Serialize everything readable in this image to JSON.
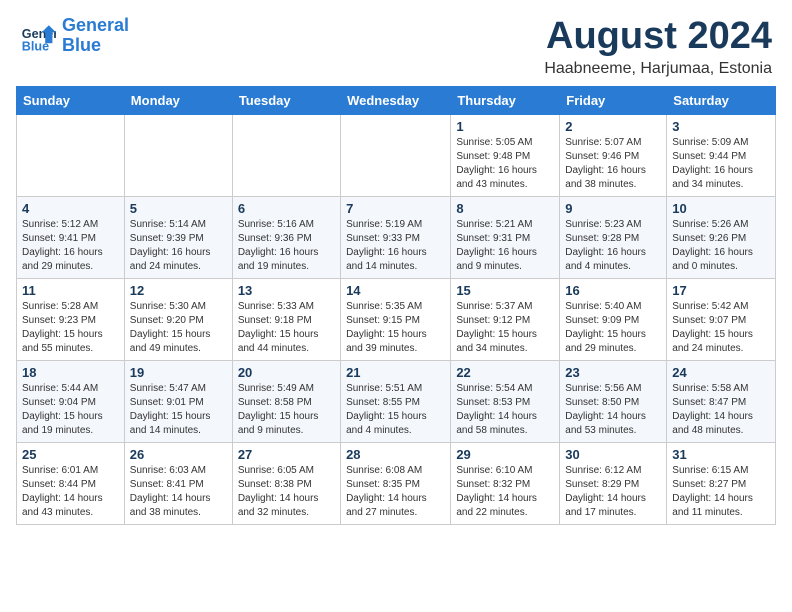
{
  "header": {
    "logo_line1": "General",
    "logo_line2": "Blue",
    "month_year": "August 2024",
    "location": "Haabneeme, Harjumaa, Estonia"
  },
  "weekdays": [
    "Sunday",
    "Monday",
    "Tuesday",
    "Wednesday",
    "Thursday",
    "Friday",
    "Saturday"
  ],
  "weeks": [
    [
      {
        "day": "",
        "info": ""
      },
      {
        "day": "",
        "info": ""
      },
      {
        "day": "",
        "info": ""
      },
      {
        "day": "",
        "info": ""
      },
      {
        "day": "1",
        "info": "Sunrise: 5:05 AM\nSunset: 9:48 PM\nDaylight: 16 hours\nand 43 minutes."
      },
      {
        "day": "2",
        "info": "Sunrise: 5:07 AM\nSunset: 9:46 PM\nDaylight: 16 hours\nand 38 minutes."
      },
      {
        "day": "3",
        "info": "Sunrise: 5:09 AM\nSunset: 9:44 PM\nDaylight: 16 hours\nand 34 minutes."
      }
    ],
    [
      {
        "day": "4",
        "info": "Sunrise: 5:12 AM\nSunset: 9:41 PM\nDaylight: 16 hours\nand 29 minutes."
      },
      {
        "day": "5",
        "info": "Sunrise: 5:14 AM\nSunset: 9:39 PM\nDaylight: 16 hours\nand 24 minutes."
      },
      {
        "day": "6",
        "info": "Sunrise: 5:16 AM\nSunset: 9:36 PM\nDaylight: 16 hours\nand 19 minutes."
      },
      {
        "day": "7",
        "info": "Sunrise: 5:19 AM\nSunset: 9:33 PM\nDaylight: 16 hours\nand 14 minutes."
      },
      {
        "day": "8",
        "info": "Sunrise: 5:21 AM\nSunset: 9:31 PM\nDaylight: 16 hours\nand 9 minutes."
      },
      {
        "day": "9",
        "info": "Sunrise: 5:23 AM\nSunset: 9:28 PM\nDaylight: 16 hours\nand 4 minutes."
      },
      {
        "day": "10",
        "info": "Sunrise: 5:26 AM\nSunset: 9:26 PM\nDaylight: 16 hours\nand 0 minutes."
      }
    ],
    [
      {
        "day": "11",
        "info": "Sunrise: 5:28 AM\nSunset: 9:23 PM\nDaylight: 15 hours\nand 55 minutes."
      },
      {
        "day": "12",
        "info": "Sunrise: 5:30 AM\nSunset: 9:20 PM\nDaylight: 15 hours\nand 49 minutes."
      },
      {
        "day": "13",
        "info": "Sunrise: 5:33 AM\nSunset: 9:18 PM\nDaylight: 15 hours\nand 44 minutes."
      },
      {
        "day": "14",
        "info": "Sunrise: 5:35 AM\nSunset: 9:15 PM\nDaylight: 15 hours\nand 39 minutes."
      },
      {
        "day": "15",
        "info": "Sunrise: 5:37 AM\nSunset: 9:12 PM\nDaylight: 15 hours\nand 34 minutes."
      },
      {
        "day": "16",
        "info": "Sunrise: 5:40 AM\nSunset: 9:09 PM\nDaylight: 15 hours\nand 29 minutes."
      },
      {
        "day": "17",
        "info": "Sunrise: 5:42 AM\nSunset: 9:07 PM\nDaylight: 15 hours\nand 24 minutes."
      }
    ],
    [
      {
        "day": "18",
        "info": "Sunrise: 5:44 AM\nSunset: 9:04 PM\nDaylight: 15 hours\nand 19 minutes."
      },
      {
        "day": "19",
        "info": "Sunrise: 5:47 AM\nSunset: 9:01 PM\nDaylight: 15 hours\nand 14 minutes."
      },
      {
        "day": "20",
        "info": "Sunrise: 5:49 AM\nSunset: 8:58 PM\nDaylight: 15 hours\nand 9 minutes."
      },
      {
        "day": "21",
        "info": "Sunrise: 5:51 AM\nSunset: 8:55 PM\nDaylight: 15 hours\nand 4 minutes."
      },
      {
        "day": "22",
        "info": "Sunrise: 5:54 AM\nSunset: 8:53 PM\nDaylight: 14 hours\nand 58 minutes."
      },
      {
        "day": "23",
        "info": "Sunrise: 5:56 AM\nSunset: 8:50 PM\nDaylight: 14 hours\nand 53 minutes."
      },
      {
        "day": "24",
        "info": "Sunrise: 5:58 AM\nSunset: 8:47 PM\nDaylight: 14 hours\nand 48 minutes."
      }
    ],
    [
      {
        "day": "25",
        "info": "Sunrise: 6:01 AM\nSunset: 8:44 PM\nDaylight: 14 hours\nand 43 minutes."
      },
      {
        "day": "26",
        "info": "Sunrise: 6:03 AM\nSunset: 8:41 PM\nDaylight: 14 hours\nand 38 minutes."
      },
      {
        "day": "27",
        "info": "Sunrise: 6:05 AM\nSunset: 8:38 PM\nDaylight: 14 hours\nand 32 minutes."
      },
      {
        "day": "28",
        "info": "Sunrise: 6:08 AM\nSunset: 8:35 PM\nDaylight: 14 hours\nand 27 minutes."
      },
      {
        "day": "29",
        "info": "Sunrise: 6:10 AM\nSunset: 8:32 PM\nDaylight: 14 hours\nand 22 minutes."
      },
      {
        "day": "30",
        "info": "Sunrise: 6:12 AM\nSunset: 8:29 PM\nDaylight: 14 hours\nand 17 minutes."
      },
      {
        "day": "31",
        "info": "Sunrise: 6:15 AM\nSunset: 8:27 PM\nDaylight: 14 hours\nand 11 minutes."
      }
    ]
  ]
}
